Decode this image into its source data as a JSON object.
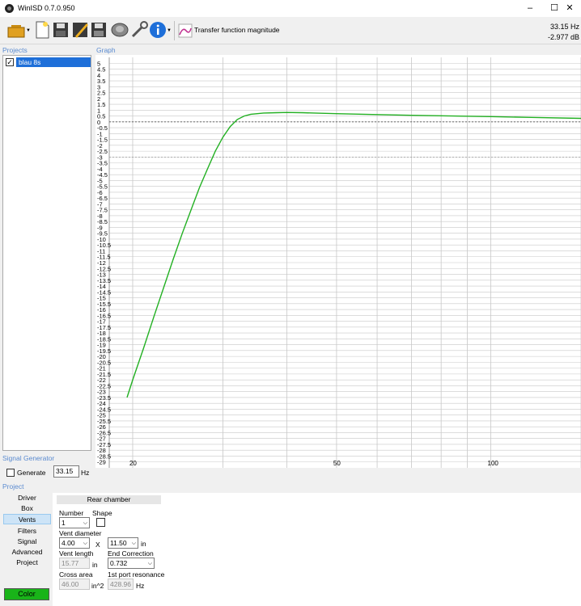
{
  "window": {
    "title": "WinISD 0.7.0.950",
    "minimize": "–",
    "maximize": "☐",
    "close": "✕"
  },
  "toolbar": {
    "transfer_label": "Transfer function magnitude",
    "icons": [
      "open-project-icon",
      "new-project-icon",
      "save-icon",
      "edit-project-icon",
      "save-as-icon",
      "driver-editor-icon",
      "tools-icon",
      "info-icon",
      "chart-icon"
    ]
  },
  "readout": {
    "frequency": "33.15 Hz",
    "level": "-2.977 dB"
  },
  "sections": {
    "projects": "Projects",
    "graph": "Graph",
    "signal_generator": "Signal Generator",
    "project": "Project"
  },
  "projects": [
    {
      "name": "blau 8s",
      "checked": true
    }
  ],
  "signal_generator": {
    "generate_label": "Generate",
    "frequency": "33.15",
    "unit": "Hz"
  },
  "nav": {
    "items": [
      "Driver",
      "Box",
      "Vents",
      "Filters",
      "Signal",
      "Advanced",
      "Project"
    ],
    "selected": "Vents",
    "color_label": "Color"
  },
  "panel": {
    "header": "Rear chamber",
    "number_label": "Number",
    "number_value": "1",
    "shape_label": "Shape",
    "vent_diameter_label": "Vent diameter",
    "vent_diameter_value": "4.00",
    "x_sep": "X",
    "vent_diameter2_value": "11.50",
    "in_unit": "in",
    "vent_length_label": "Vent length",
    "vent_length_value": "15.77",
    "vent_length_unit": "in",
    "end_correction_label": "End Correction",
    "end_correction_value": "0.732",
    "cross_area_label": "Cross area",
    "cross_area_value": "46.00",
    "cross_area_unit": "in^2",
    "port_resonance_label": "1st port resonance",
    "port_resonance_value": "428.96",
    "port_resonance_unit": "Hz"
  },
  "chart_data": {
    "type": "line",
    "title": "",
    "xlabel": "",
    "ylabel": "",
    "x_scale": "log",
    "xlim": [
      18,
      150
    ],
    "ylim": [
      -29.5,
      5.5
    ],
    "x_tick_labels": [
      "20",
      "50",
      "100"
    ],
    "y_ticks": [
      5,
      4.5,
      4,
      3.5,
      3,
      2.5,
      2,
      1.5,
      1,
      0.5,
      0,
      -0.5,
      -1,
      -1.5,
      -2,
      -2.5,
      -3,
      -3.5,
      -4,
      -4.5,
      -5,
      -5.5,
      -6,
      -6.5,
      -7,
      -7.5,
      -8,
      -8.5,
      -9,
      -9.5,
      -10,
      -10.5,
      -11,
      -11.5,
      -12,
      -12.5,
      -13,
      -13.5,
      -14,
      -14.5,
      -15,
      -15.5,
      -16,
      -16.5,
      -17,
      -17.5,
      -18,
      -18.5,
      -19,
      -19.5,
      -20,
      -20.5,
      -21,
      -21.5,
      -22,
      -22.5,
      -23,
      -23.5,
      -24,
      -24.5,
      -25,
      -25.5,
      -26,
      -26.5,
      -27,
      -27.5,
      -28,
      -28.5,
      -29
    ],
    "grid": true,
    "reference_lines": [
      0,
      -3
    ],
    "series": [
      {
        "color": "#22b022",
        "x": [
          19.5,
          20,
          21,
          22,
          23,
          24,
          25,
          26,
          27,
          28,
          29,
          30,
          31,
          32,
          33,
          34,
          35,
          36,
          38,
          40,
          43,
          46,
          50,
          60,
          70,
          80,
          100,
          120,
          150
        ],
        "y": [
          -23.5,
          -22.0,
          -19.3,
          -16.6,
          -14.1,
          -11.7,
          -9.5,
          -7.5,
          -5.6,
          -4.0,
          -2.5,
          -1.3,
          -0.4,
          0.2,
          0.5,
          0.65,
          0.7,
          0.75,
          0.78,
          0.8,
          0.78,
          0.74,
          0.7,
          0.62,
          0.56,
          0.52,
          0.45,
          0.38,
          0.3
        ]
      }
    ]
  }
}
